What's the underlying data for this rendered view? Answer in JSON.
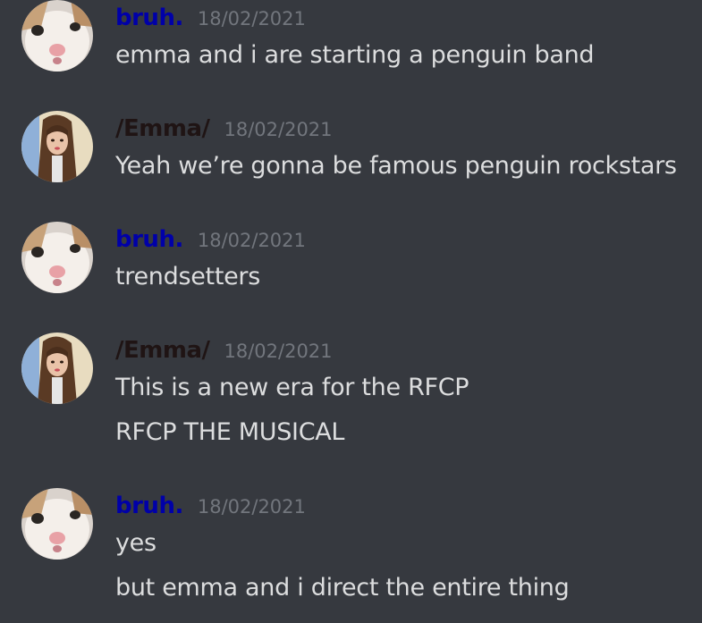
{
  "colors": {
    "background": "#36393f",
    "username_bruh": "#0000a8",
    "username_emma": "#1f1414",
    "timestamp": "#72767d",
    "message_text": "#dcddde"
  },
  "messages": [
    {
      "avatar_icon": "cat-avatar-icon",
      "username": "bruh.",
      "timestamp": "18/02/2021",
      "lines": [
        "emma and i are starting a penguin band"
      ]
    },
    {
      "avatar_icon": "girl-avatar-icon",
      "username": "/Emma/",
      "timestamp": "18/02/2021",
      "lines": [
        "Yeah we’re gonna be famous penguin rockstars"
      ]
    },
    {
      "avatar_icon": "cat-avatar-icon",
      "username": "bruh.",
      "timestamp": "18/02/2021",
      "lines": [
        "trendsetters"
      ]
    },
    {
      "avatar_icon": "girl-avatar-icon",
      "username": "/Emma/",
      "timestamp": "18/02/2021",
      "lines": [
        "This is a new era for the RFCP",
        "RFCP THE MUSICAL"
      ]
    },
    {
      "avatar_icon": "cat-avatar-icon",
      "username": "bruh.",
      "timestamp": "18/02/2021",
      "lines": [
        "yes",
        "but emma and i direct the entire thing"
      ]
    }
  ]
}
